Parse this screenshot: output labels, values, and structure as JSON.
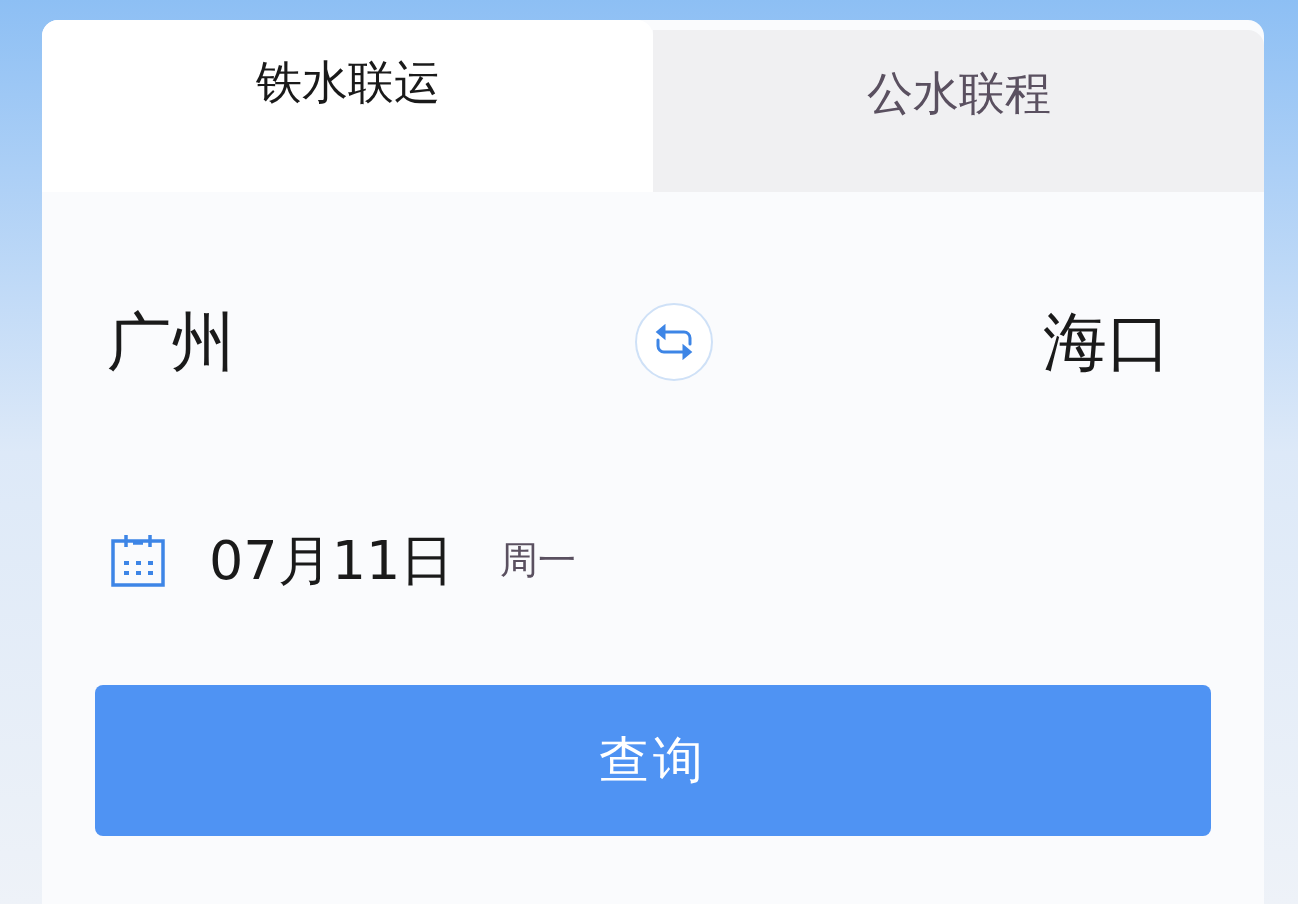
{
  "tabs": [
    {
      "label": "铁水联运",
      "selected": true
    },
    {
      "label": "公水联程",
      "selected": false
    }
  ],
  "route": {
    "from": "广州",
    "to": "海口"
  },
  "date": {
    "value": "07月11日",
    "weekday": "周一"
  },
  "search_button": "查询"
}
